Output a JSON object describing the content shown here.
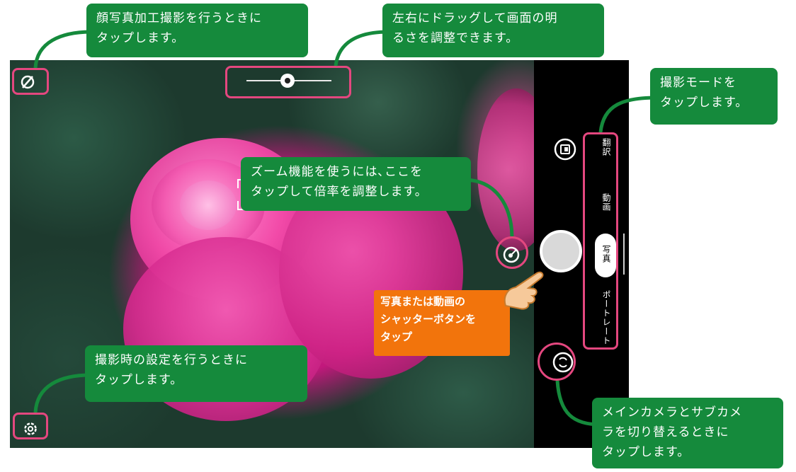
{
  "camera": {
    "modes": [
      {
        "label": "翻訳"
      },
      {
        "label": "動画"
      },
      {
        "label": "写真"
      },
      {
        "label": "ポートレート"
      }
    ],
    "active_mode": "写真"
  },
  "callouts": {
    "face_retouch": "顔写真加工撮影を行うときに\nタップします。",
    "brightness": "左右にドラッグして画面の明\nるさを調整できます。",
    "shooting_mode": "撮影モードを\nタップします。",
    "zoom": "ズーム機能を使うには､ここを\nタップして倍率を調整します。",
    "shutter": "写真または動画の\nシャッターボタンを\nタップ",
    "settings": "撮影時の設定を行うときに\nタップします。",
    "switch_camera": "メインカメラとサブカメ\nラを切り替えるときに\nタップします。"
  },
  "colors": {
    "callout_green": "#158a3c",
    "highlight_pink": "#e4477f",
    "shutter_orange": "#f2740c"
  },
  "icons": {
    "face_retouch": "face-retouch-off-icon",
    "brightness": "brightness-sun-icon",
    "gallery": "gallery-thumbnail-icon",
    "zoom": "zoom-lens-icon",
    "switch": "switch-camera-icon",
    "settings": "gear-icon",
    "hand": "pointing-hand-icon"
  }
}
